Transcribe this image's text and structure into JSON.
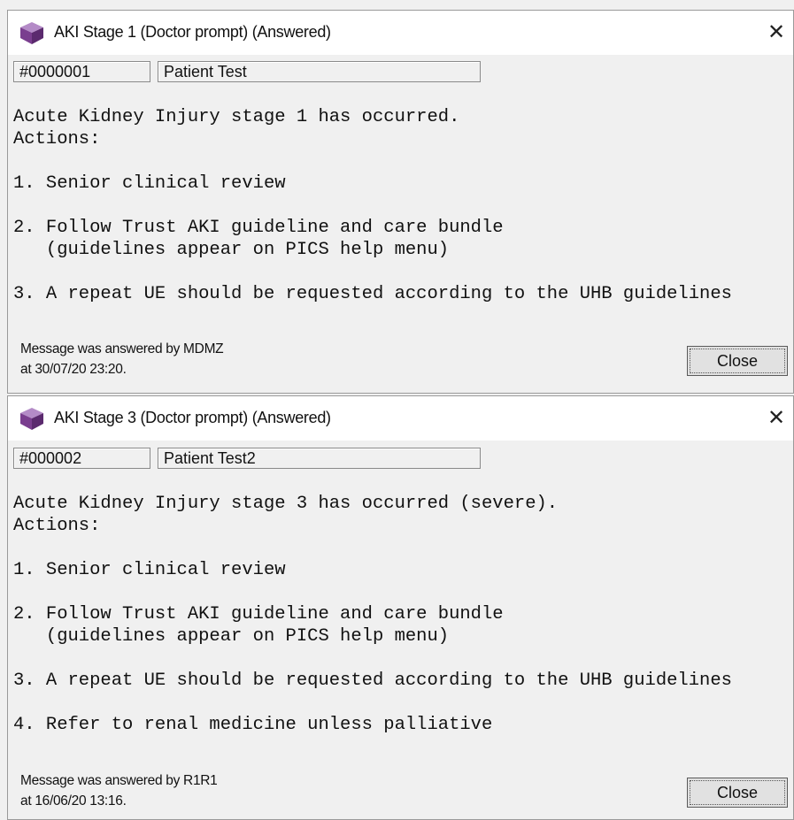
{
  "dialogs": [
    {
      "title": "AKI Stage 1 (Doctor prompt) (Answered)",
      "patient_id": "#0000001",
      "patient_name": "Patient Test",
      "message_lines": [
        "Acute Kidney Injury stage 1 has occurred.",
        "Actions:",
        "",
        "1. Senior clinical review",
        "",
        "2. Follow Trust AKI guideline and care bundle",
        "   (guidelines appear on PICS help menu)",
        "",
        "3. A repeat UE should be requested according to the UHB guidelines"
      ],
      "answered_line1": "Message was answered by MDMZ",
      "answered_line2": "at 30/07/20 23:20.",
      "close_button": "Close",
      "close_icon": "close-x-icon",
      "app_icon": "purple-cube-icon"
    },
    {
      "title": "AKI Stage 3 (Doctor prompt) (Answered)",
      "patient_id": "#000002",
      "patient_name": "Patient Test2",
      "message_lines": [
        "Acute Kidney Injury stage 3 has occurred (severe).",
        "Actions:",
        "",
        "1. Senior clinical review",
        "",
        "2. Follow Trust AKI guideline and care bundle",
        "   (guidelines appear on PICS help menu)",
        "",
        "3. A repeat UE should be requested according to the UHB guidelines",
        "",
        "4. Refer to renal medicine unless palliative"
      ],
      "answered_line1": "Message was answered by R1R1",
      "answered_line2": "at 16/06/20 13:16.",
      "close_button": "Close",
      "close_icon": "close-x-icon",
      "app_icon": "purple-cube-icon"
    }
  ],
  "colors": {
    "icon_purple": "#7a3e8f",
    "titlebar": "#ffffff",
    "dialog_bg": "#f0f0f0"
  }
}
